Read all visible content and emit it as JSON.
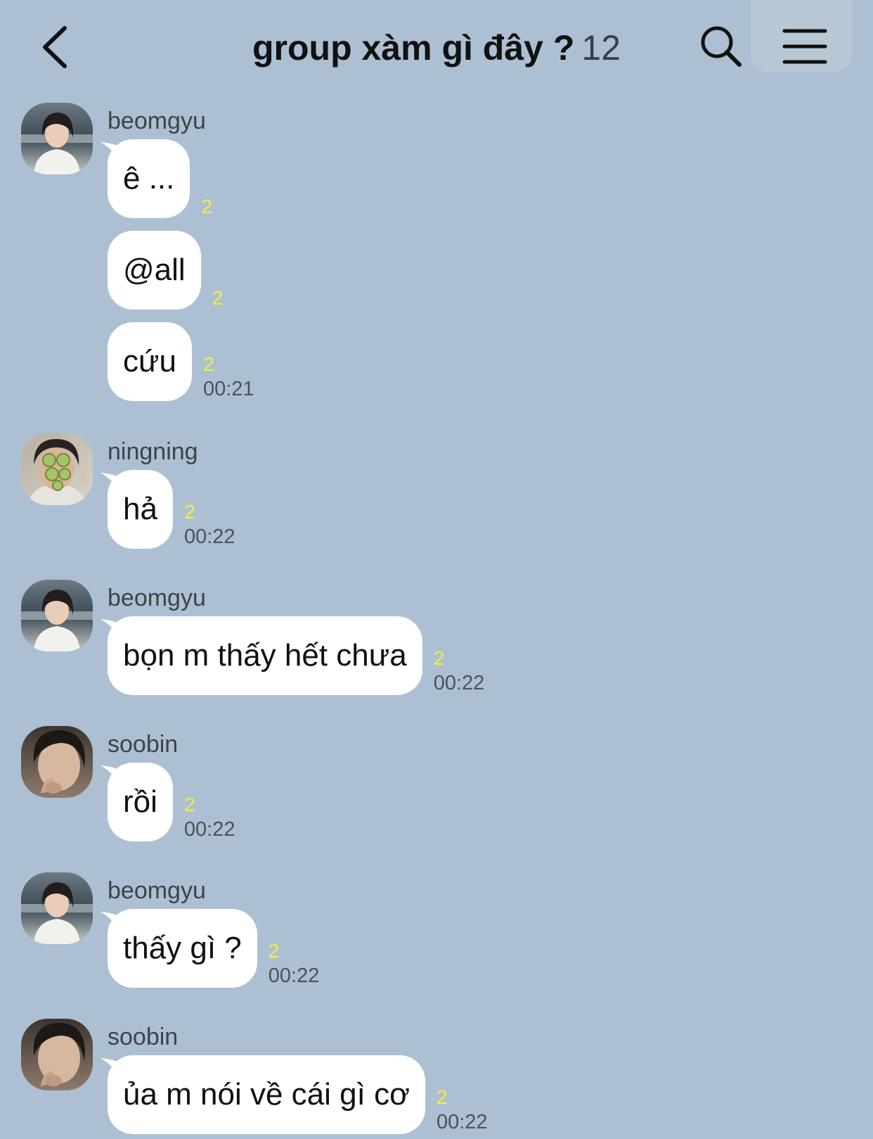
{
  "header": {
    "title": "group xàm gì đây ?",
    "member_count": "12"
  },
  "colors": {
    "background": "#adc0d3",
    "bubble": "#ffffff",
    "read_count": "#f4ee3a"
  },
  "icons": {
    "back": "chevron-left-icon",
    "search": "search-icon",
    "menu": "hamburger-menu-icon"
  },
  "messages": [
    {
      "sender": "beomgyu",
      "avatar": "beomgyu-avatar",
      "bubbles": [
        {
          "text": "ê ...",
          "read_count": "2",
          "time": ""
        },
        {
          "text": "@all",
          "read_count": "2",
          "time": ""
        },
        {
          "text": "cứu",
          "read_count": "2",
          "time": "00:21"
        }
      ]
    },
    {
      "sender": "ningning",
      "avatar": "ningning-avatar",
      "bubbles": [
        {
          "text": "hả",
          "read_count": "2",
          "time": "00:22"
        }
      ]
    },
    {
      "sender": "beomgyu",
      "avatar": "beomgyu-avatar",
      "bubbles": [
        {
          "text": "bọn m thấy hết chưa",
          "read_count": "2",
          "time": "00:22"
        }
      ]
    },
    {
      "sender": "soobin",
      "avatar": "soobin-avatar",
      "bubbles": [
        {
          "text": "rồi",
          "read_count": "2",
          "time": "00:22"
        }
      ]
    },
    {
      "sender": "beomgyu",
      "avatar": "beomgyu-avatar",
      "bubbles": [
        {
          "text": "thấy gì ?",
          "read_count": "2",
          "time": "00:22"
        }
      ]
    },
    {
      "sender": "soobin",
      "avatar": "soobin-avatar",
      "bubbles": [
        {
          "text": "ủa m nói về cái gì cơ",
          "read_count": "2",
          "time": "00:22"
        }
      ]
    }
  ]
}
